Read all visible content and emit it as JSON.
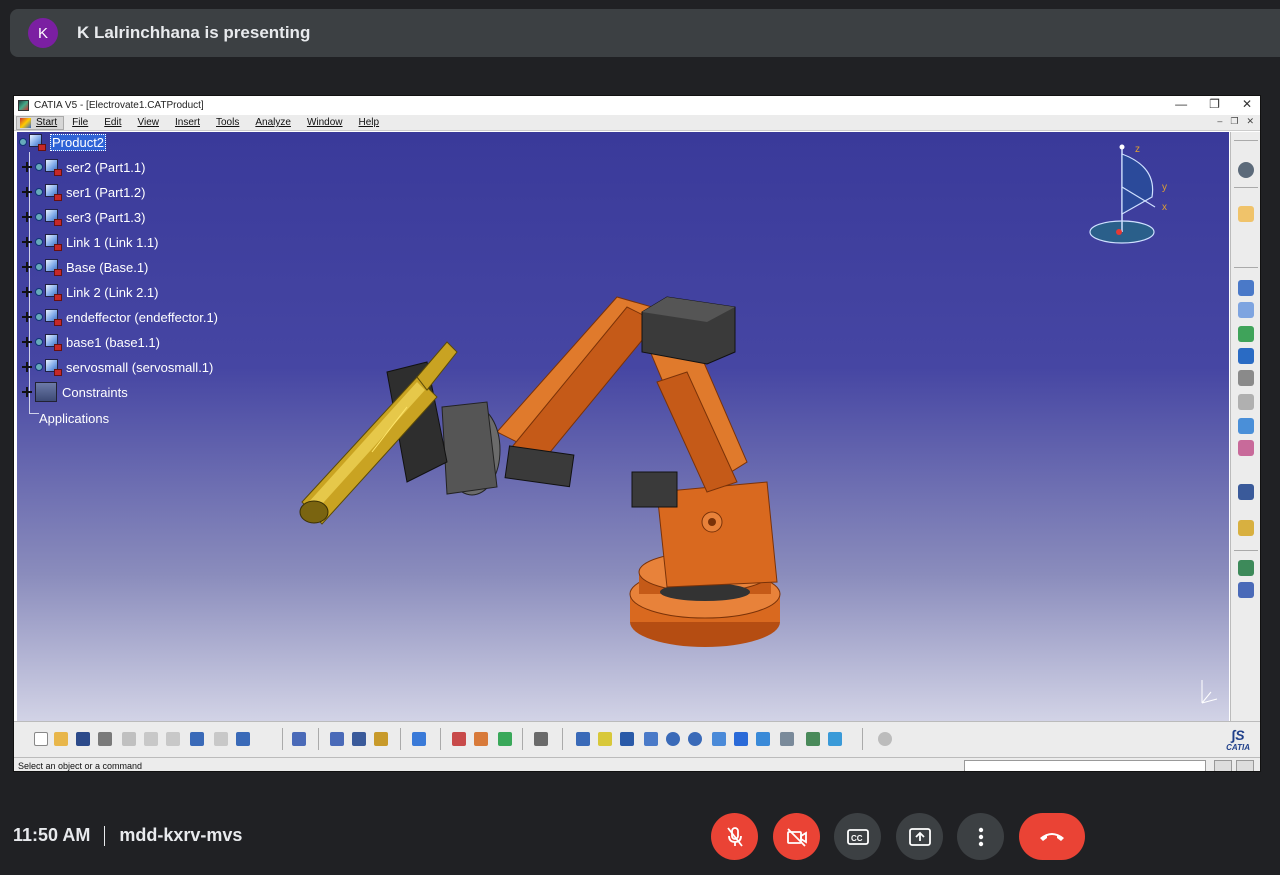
{
  "meet": {
    "avatar_initial": "K",
    "presenter_text": "K Lalrinchhana is presenting",
    "time": "11:50 AM",
    "meeting_code": "mdd-kxrv-mvs"
  },
  "catia": {
    "window_title": "CATIA V5 - [Electrovate1.CATProduct]",
    "menu": [
      "Start",
      "File",
      "Edit",
      "View",
      "Insert",
      "Tools",
      "Analyze",
      "Window",
      "Help"
    ],
    "tree": {
      "root": "Product2",
      "items": [
        "ser2 (Part1.1)",
        "ser1 (Part1.2)",
        "ser3 (Part1.3)",
        "Link 1 (Link 1.1)",
        "Base (Base.1)",
        "Link 2 (Link 2.1)",
        "endeffector (endeffector.1)",
        "base1 (base1.1)",
        "servosmall (servosmall.1)"
      ],
      "constraints": "Constraints",
      "applications": "Applications"
    },
    "axis_labels": {
      "z": "z",
      "y": "y",
      "x": "x"
    },
    "status_text": "Select an object or a command",
    "logo_text": "CATIA"
  },
  "colors": {
    "meet_bg": "#202124",
    "meet_bar": "#3c4043",
    "meet_red": "#ea4335",
    "viewport_top": "#3a3a9a",
    "robot_orange": "#d9691f"
  }
}
